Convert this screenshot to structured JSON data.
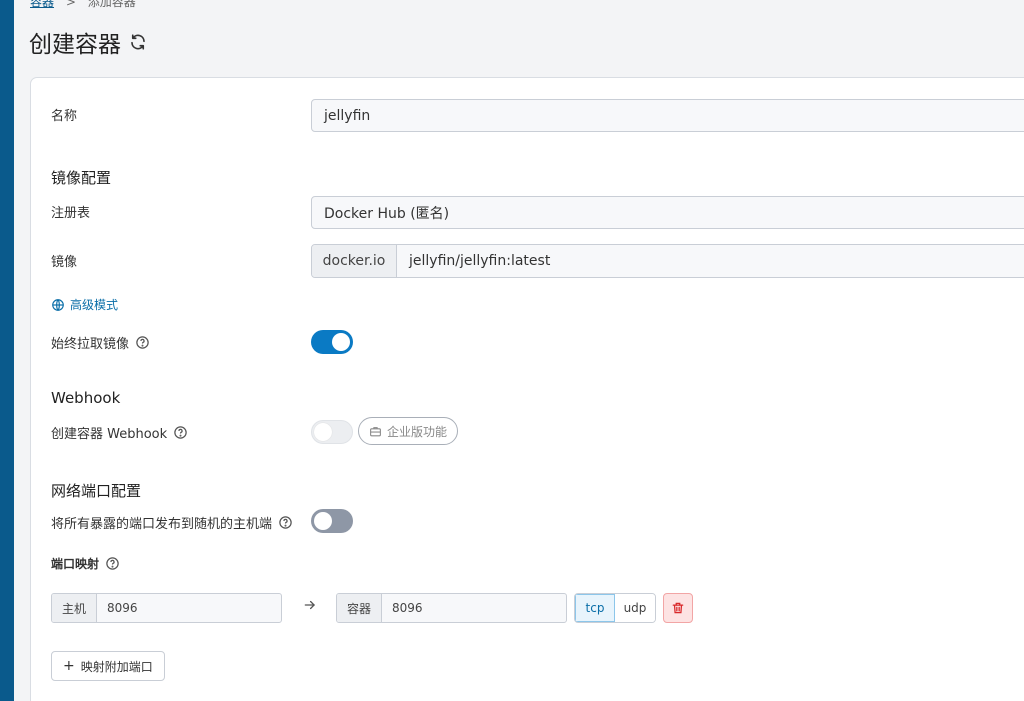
{
  "breadcrumb": {
    "parent": "容器",
    "separator": ">",
    "current": "添加容器"
  },
  "page": {
    "title": "创建容器"
  },
  "form": {
    "name_label": "名称",
    "name_value": "jellyfin",
    "image_section_title": "镜像配置",
    "registry_label": "注册表",
    "registry_value": "Docker Hub (匿名)",
    "image_label": "镜像",
    "image_prefix": "docker.io",
    "image_value": "jellyfin/jellyfin:latest",
    "advanced_mode_label": "高级模式",
    "always_pull_label": "始终拉取镜像",
    "always_pull_on": true,
    "webhook_section_title": "Webhook",
    "webhook_label": "创建容器 Webhook",
    "webhook_on": false,
    "business_badge": "企业版功能",
    "network_section_title": "网络端口配置",
    "publish_all_label": "将所有暴露的端口发布到随机的主机端",
    "publish_all_on": false,
    "port_mapping_label": "端口映射",
    "ports": [
      {
        "host_label": "主机",
        "host_value": "8096",
        "container_label": "容器",
        "container_value": "8096",
        "protocols": [
          "tcp",
          "udp"
        ],
        "active_protocol": "tcp"
      }
    ],
    "add_port_label": "映射附加端口"
  },
  "icons": {
    "refresh": "refresh-icon",
    "globe": "globe-icon",
    "help": "help-icon",
    "briefcase": "briefcase-icon",
    "arrow": "arrow-right-icon",
    "trash": "trash-icon",
    "plus": "plus-icon"
  },
  "colors": {
    "accent": "#0a7ac4",
    "sidebar": "#0a5a8c",
    "danger": "#d9292b"
  }
}
